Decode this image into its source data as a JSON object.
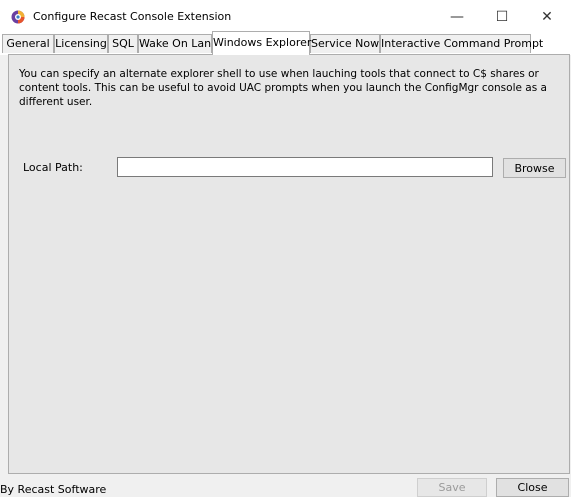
{
  "window": {
    "title": "Configure Recast Console Extension",
    "minimize_glyph": "—",
    "maximize_glyph": "☐",
    "close_glyph": "✕",
    "icon": "recast-logo-icon"
  },
  "tabs": [
    {
      "label": "General"
    },
    {
      "label": "Licensing"
    },
    {
      "label": "SQL"
    },
    {
      "label": "Wake On Lan"
    },
    {
      "label": "Windows Explorer",
      "active": true
    },
    {
      "label": "Service Now"
    },
    {
      "label": "Interactive Command Prompt"
    }
  ],
  "panel": {
    "description": "You can specify an alternate explorer shell to use when lauching tools that connect to C$ shares or content tools. This can be useful to avoid UAC prompts when you launch the ConfigMgr console as a different user.",
    "local_path_label": "Local Path:",
    "local_path_value": "",
    "browse_label": "Browse"
  },
  "footer": {
    "credit": "By Recast Software",
    "save_label": "Save",
    "close_label": "Close"
  },
  "colors": {
    "active_tab": "#ffffff",
    "panel_background": "#e7e7e7",
    "disabled_text": "#9a9a9a"
  }
}
